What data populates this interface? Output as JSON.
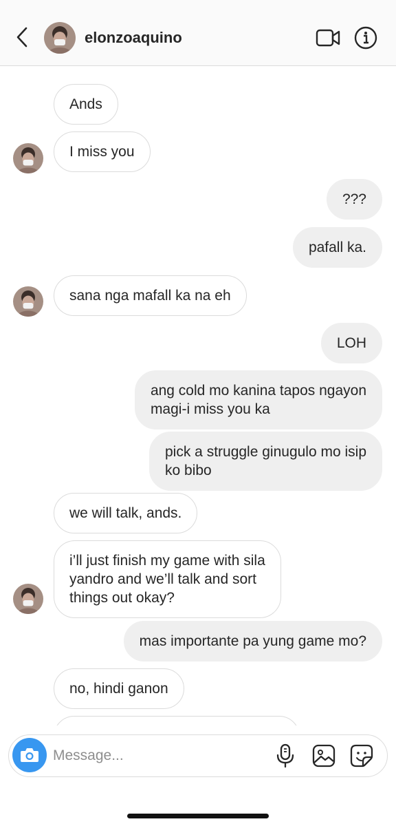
{
  "header": {
    "username": "elonzoaquino",
    "back_icon": "chevron-left-icon",
    "video_icon": "video-camera-icon",
    "info_icon": "info-icon"
  },
  "messages": [
    {
      "direction": "in",
      "text": "Ands"
    },
    {
      "direction": "in",
      "text": "I miss you"
    },
    {
      "direction": "out",
      "text": "???"
    },
    {
      "direction": "out",
      "text": "pafall ka."
    },
    {
      "direction": "in",
      "text": "sana nga mafall ka na eh"
    },
    {
      "direction": "out",
      "text": "LOH"
    },
    {
      "direction": "out",
      "text": "ang cold mo kanina tapos ngayon\nmagi-i miss you ka"
    },
    {
      "direction": "out",
      "text": "pick a struggle ginugulo mo isip\nko bibo"
    },
    {
      "direction": "in",
      "text": "we will talk, ands."
    },
    {
      "direction": "in",
      "text": "i’ll just finish my game with sila\nyandro and we’ll talk and sort\nthings out okay?"
    },
    {
      "direction": "out",
      "text": "mas importante pa yung game mo?"
    },
    {
      "direction": "in",
      "text": "no, hindi ganon"
    }
  ],
  "composer": {
    "placeholder": "Message...",
    "camera_icon": "camera-icon",
    "mic_icon": "microphone-icon",
    "gallery_icon": "gallery-icon",
    "sticker_icon": "sticker-icon"
  },
  "colors": {
    "accent": "#3897f0",
    "outgoing_bubble": "#efefef",
    "incoming_border": "#dbdbdb",
    "text": "#262626",
    "placeholder": "#8e8e8e"
  }
}
